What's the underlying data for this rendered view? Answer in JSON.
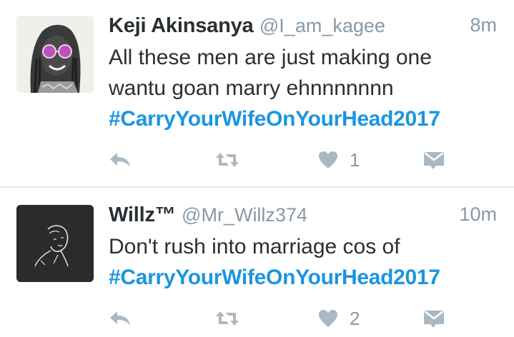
{
  "tweets": [
    {
      "display_name": "Keji Akinsanya",
      "screen_name": "@I_am_kagee",
      "time": "8m",
      "text_lines": [
        "All these men are just making one",
        "wantu goan marry ehnnnnnnn"
      ],
      "hashtag": "#CarryYourWifeOnYourHead2017",
      "likes": "1",
      "avatar": "woman-with-pink-sunglasses"
    },
    {
      "display_name": "Willz™",
      "screen_name": "@Mr_Willz374",
      "time": "10m",
      "text_lines": [
        "Don't rush into marriage cos of"
      ],
      "hashtag": "#CarryYourWifeOnYourHead2017",
      "likes": "2",
      "avatar": "line-art-man-portrait"
    }
  ],
  "icons": {
    "reply": "reply-icon",
    "retweet": "retweet-icon",
    "like": "heart-icon",
    "message": "direct-message-icon"
  },
  "colors": {
    "hashtag": "#1b95e0",
    "icon": "#aab8c2",
    "secondary_text": "#8899a6",
    "primary_text": "#292f33"
  }
}
